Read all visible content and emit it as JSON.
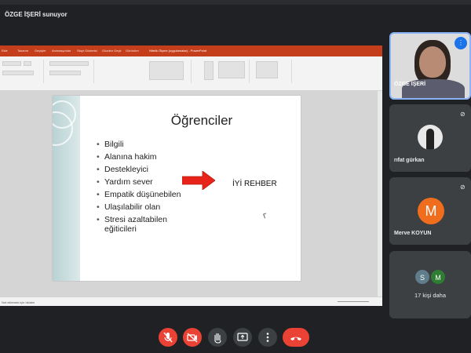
{
  "presenter": {
    "banner": "ÖZGE İŞERİ sunuyor"
  },
  "powerpoint": {
    "tabs": [
      "Ekle",
      "Tasarım",
      "Geçişler",
      "Animasyonlar",
      "Slayt Gösterisi",
      "Gözden Geçir",
      "Görünüm"
    ],
    "document_title": "Nitelik Ölçme (uygulamalar) - PowerPoint",
    "status_notes": "Not eklemek için tıklatın"
  },
  "slide": {
    "title": "Öğrenciler",
    "bullets": [
      "Bilgili",
      "Alanına hakim",
      "Destekleyici",
      "Yardım sever",
      "Empatik düşünebilen",
      "Ulaşılabilir olan",
      "Stresi azaltabilen eğiticileri"
    ],
    "callout": "İYİ REHBER",
    "arrow_color": "#e8241a"
  },
  "participants": {
    "self_label": "ÖZGE İŞERİ",
    "tiles": [
      {
        "name": "rıfat gürkan",
        "avatar": "photo"
      },
      {
        "name": "Merve KOYUN",
        "avatar_letter": "M",
        "avatar_color": "#f06d1d"
      }
    ],
    "more": {
      "label": "17 kişi daha",
      "avatars": [
        {
          "letter": "S",
          "color": "#607d8b"
        },
        {
          "letter": "M",
          "color": "#2e7d32"
        }
      ]
    }
  },
  "controls": {
    "mic_icon": "mic-off-icon",
    "camera_icon": "camera-off-icon",
    "hand_icon": "raise-hand-icon",
    "present_icon": "present-screen-icon",
    "more_icon": "more-options-icon",
    "hangup_icon": "hang-up-icon"
  }
}
